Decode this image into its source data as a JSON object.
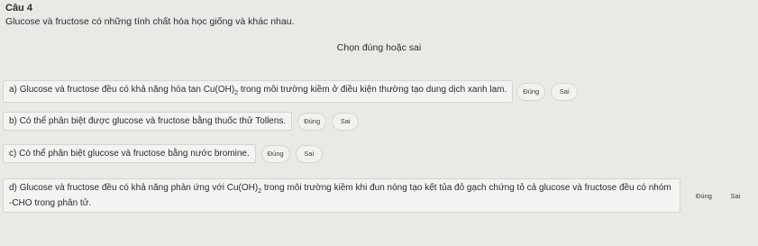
{
  "question": {
    "title": "Câu 4",
    "description": "Glucose và fructose có những tính chất hóa học giống và khác nhau.",
    "instruction": "Chọn đúng hoặc sai"
  },
  "items": [
    {
      "label": "a)",
      "text_before": "Glucose và fructose đều có khả năng hòa tan Cu(OH)",
      "subscript": "2",
      "text_after": " trong môi trường kiềm ở điều kiện thường tạo dung dịch xanh lam.",
      "true_label": "Đúng",
      "false_label": "Sai"
    },
    {
      "label": "b)",
      "text": "Có thể phân biệt được glucose và fructose bằng thuốc thử Tollens.",
      "true_label": "Đúng",
      "false_label": "Sai"
    },
    {
      "label": "c)",
      "text": "Có thể phân biệt glucose và fructose bằng nước bromine.",
      "true_label": "Đúng",
      "false_label": "Sai"
    },
    {
      "label": "d)",
      "text_before": "Glucose và fructose đều có khả năng phản ứng với Cu(OH)",
      "subscript": "2",
      "text_after": " trong môi trường kiềm khi đun nóng tạo kết tủa đỏ gạch chứng tỏ cả glucose và fructose đều có nhóm -CHO trong phân tử.",
      "true_label": "Đúng",
      "false_label": "Sai"
    }
  ]
}
